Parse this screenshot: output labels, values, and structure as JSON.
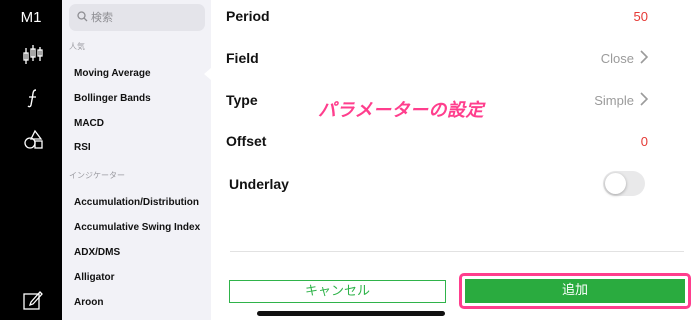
{
  "rail": {
    "timeframe": "M1",
    "icons": [
      "candlestick-icon",
      "function-icon",
      "shapes-icon",
      "edit-icon"
    ]
  },
  "list": {
    "search_placeholder": "検索",
    "section_popular": "人気",
    "popular": [
      "Moving Average",
      "Bollinger Bands",
      "MACD",
      "RSI"
    ],
    "section_indicators": "インジケーター",
    "indicators": [
      "Accumulation/Distribution",
      "Accumulative Swing Index",
      "ADX/DMS",
      "Alligator",
      "Aroon"
    ],
    "selected": "Moving Average"
  },
  "settings": {
    "period_label": "Period",
    "period_value": "50",
    "field_label": "Field",
    "field_value": "Close",
    "type_label": "Type",
    "type_value": "Simple",
    "offset_label": "Offset",
    "offset_value": "0",
    "underlay_label": "Underlay",
    "underlay_on": false
  },
  "annotation": "パラメーターの設定",
  "buttons": {
    "cancel": "キャンセル",
    "add": "追加"
  },
  "colors": {
    "accent_green": "#2aab3f",
    "value_red": "#e53935",
    "highlight_pink": "#ff3e8d"
  }
}
